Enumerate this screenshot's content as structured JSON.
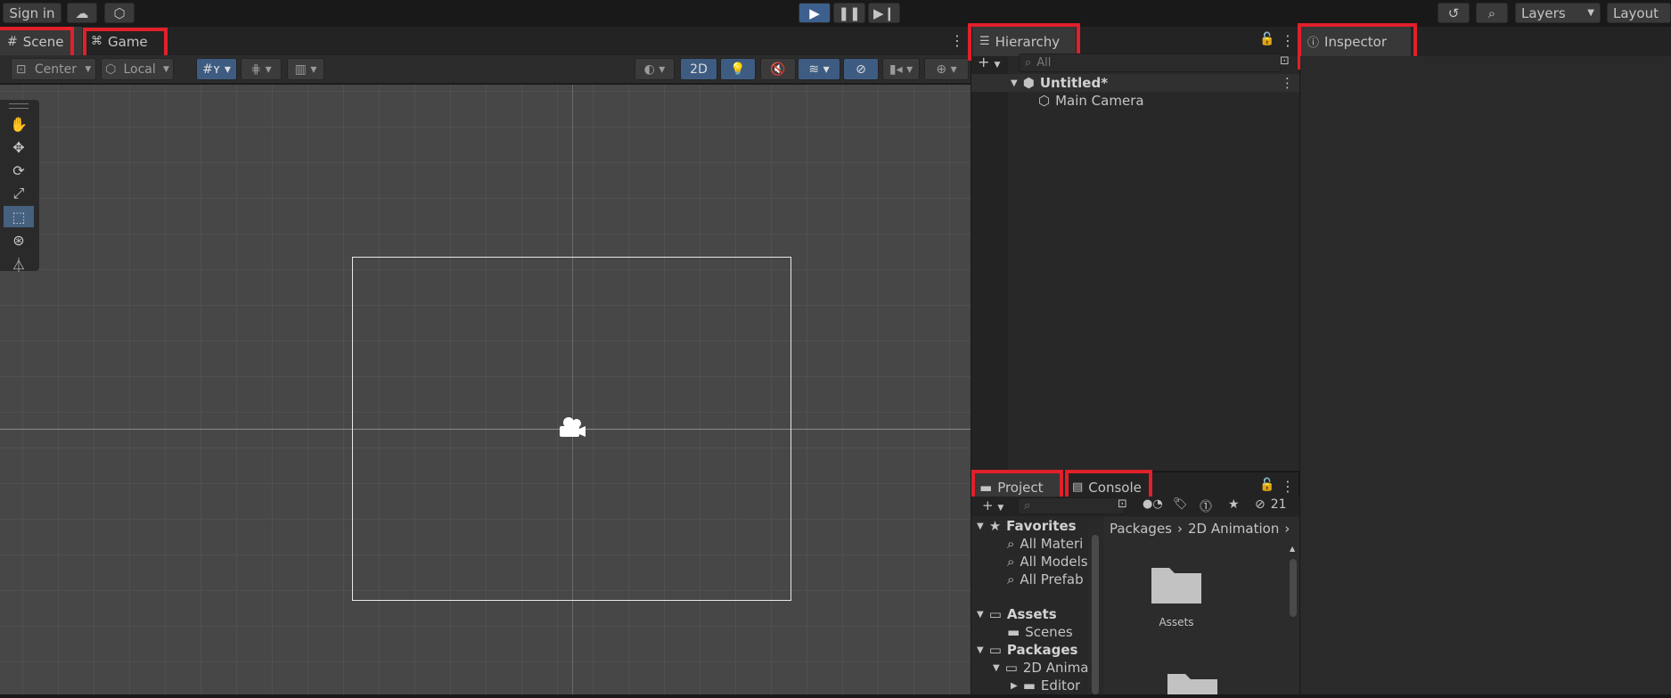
{
  "topbar": {
    "sign_in": "Sign in",
    "cloud_icon": "cloud-icon",
    "collab_icon": "collab-icon",
    "play_icon": "play-icon",
    "pause_icon": "pause-icon",
    "step_icon": "step-icon",
    "history_icon": "history-icon",
    "search_icon": "search-icon",
    "layers_label": "Layers",
    "layout_label": "Layout"
  },
  "scene_tabs": {
    "scene": "Scene",
    "game": "Game"
  },
  "scene_toolbar": {
    "pivot": "Center",
    "space": "Local",
    "mode_2d": "2D"
  },
  "scene": {
    "camera_icon": "camera-icon"
  },
  "hierarchy": {
    "tab": "Hierarchy",
    "search_placeholder": "All",
    "scene_name": "Untitled*",
    "items": [
      "Main Camera"
    ]
  },
  "inspector": {
    "tab": "Inspector"
  },
  "project_tabs": {
    "project": "Project",
    "console": "Console",
    "hidden_count": "21"
  },
  "project": {
    "favorites_label": "Favorites",
    "favorites": [
      "All Materi",
      "All Models",
      "All Prefab"
    ],
    "assets_label": "Assets",
    "assets_children": [
      "Scenes"
    ],
    "packages_label": "Packages",
    "packages_children": [
      "2D Anima"
    ],
    "anim_children": [
      "Editor"
    ],
    "breadcrumb": [
      "Packages",
      "2D Animation"
    ],
    "grid_items": [
      "Assets"
    ]
  },
  "colors": {
    "accent_blue": "#3e5c82",
    "highlight_red": "#e0202a",
    "background": "#191919"
  }
}
